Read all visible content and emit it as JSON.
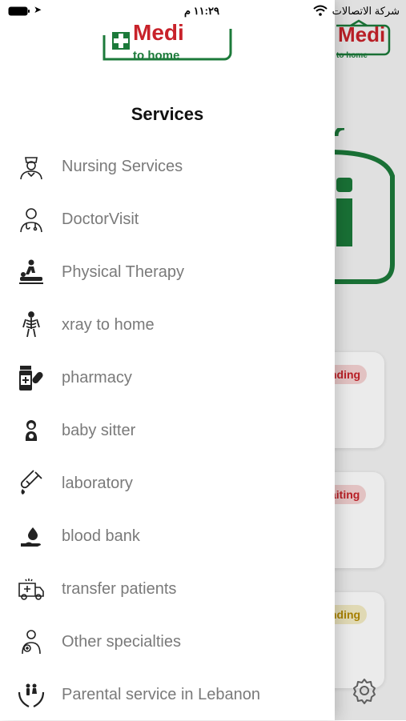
{
  "status_bar": {
    "carrier": "شركة الاتصالات",
    "time": "١١:٢٩ م"
  },
  "background": {
    "logo_text_main": "Medi",
    "logo_text_sub": "to home",
    "badges": [
      {
        "label": "nding",
        "color": "#c8222a",
        "bg": "#f6d3d3"
      },
      {
        "label": "aiting",
        "color": "#c8222a",
        "bg": "#f6d3d3"
      },
      {
        "label": "nding",
        "color": "#b58a00",
        "bg": "#f4ecc4"
      }
    ]
  },
  "drawer": {
    "logo": {
      "main": "Medi",
      "sub": "to home"
    },
    "title": "Services",
    "items": [
      {
        "label": "Nursing Services",
        "icon": "nurse-icon"
      },
      {
        "label": "DoctorVisit",
        "icon": "doctor-icon"
      },
      {
        "label": "Physical Therapy",
        "icon": "massage-icon"
      },
      {
        "label": "xray to home",
        "icon": "xray-icon"
      },
      {
        "label": "pharmacy",
        "icon": "pill-bottle-icon"
      },
      {
        "label": "baby sitter",
        "icon": "baby-icon"
      },
      {
        "label": "laboratory",
        "icon": "test-tube-icon"
      },
      {
        "label": "blood bank",
        "icon": "blood-drop-hand-icon"
      },
      {
        "label": "transfer patients",
        "icon": "ambulance-icon"
      },
      {
        "label": "Other specialties",
        "icon": "specialist-icon"
      },
      {
        "label": "Parental service in Lebanon",
        "icon": "family-care-icon"
      }
    ]
  },
  "colors": {
    "brand_green": "#1c7a3a",
    "brand_red": "#c8222a",
    "menu_text": "#7a7a7a"
  }
}
